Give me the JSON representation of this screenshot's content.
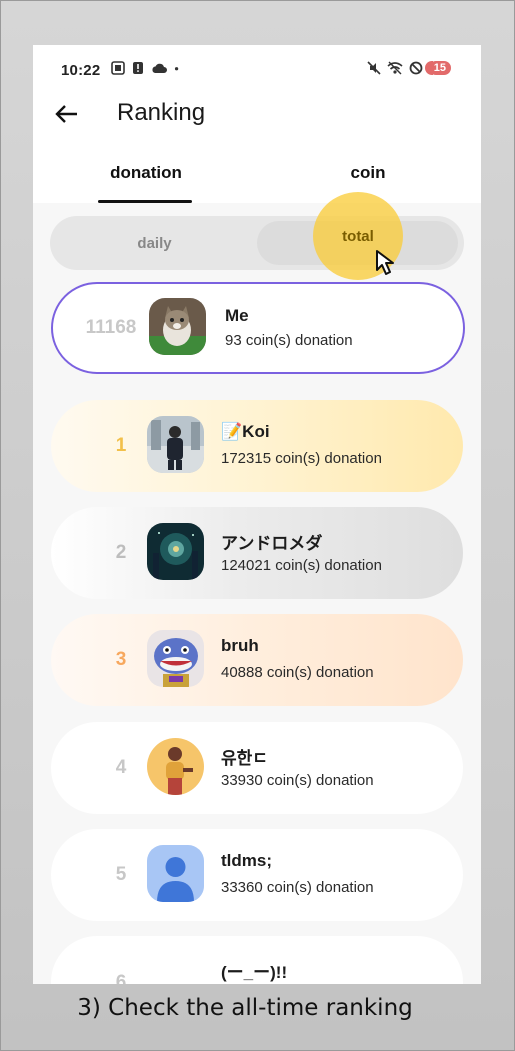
{
  "status_bar": {
    "time": "10:22",
    "battery_badge": "15",
    "icons_left": [
      "screenshot-icon",
      "alert-icon",
      "cloud-icon",
      "dot-icon"
    ],
    "icons_right": [
      "mute-icon",
      "wifi-icon",
      "block-icon"
    ]
  },
  "header": {
    "title": "Ranking"
  },
  "tabs": [
    {
      "label": "donation",
      "active": true
    },
    {
      "label": "coin",
      "active": false
    }
  ],
  "period_toggle": {
    "options": [
      "daily",
      "total"
    ],
    "selected": "total"
  },
  "me": {
    "rank": "11168",
    "name": "Me",
    "subtitle": "93 coin(s) donation"
  },
  "ranking": [
    {
      "rank": "1",
      "name": "📝Koi",
      "subtitle": "172315 coin(s) donation"
    },
    {
      "rank": "2",
      "name": "アンドロメダ",
      "subtitle": "124021 coin(s) donation"
    },
    {
      "rank": "3",
      "name": "bruh",
      "subtitle": "40888 coin(s) donation"
    },
    {
      "rank": "4",
      "name": "유한ㄷ",
      "subtitle": "33930 coin(s) donation"
    },
    {
      "rank": "5",
      "name": "tldms;",
      "subtitle": "33360 coin(s) donation"
    },
    {
      "rank": "6",
      "name": "(ー_ー)!!",
      "subtitle": ""
    }
  ],
  "caption": "3) Check the all-time ranking",
  "colors": {
    "accent": "#7b61e0",
    "gold": "#f2c04a",
    "bronze": "#f7a85e",
    "highlight": "#facd3c"
  }
}
